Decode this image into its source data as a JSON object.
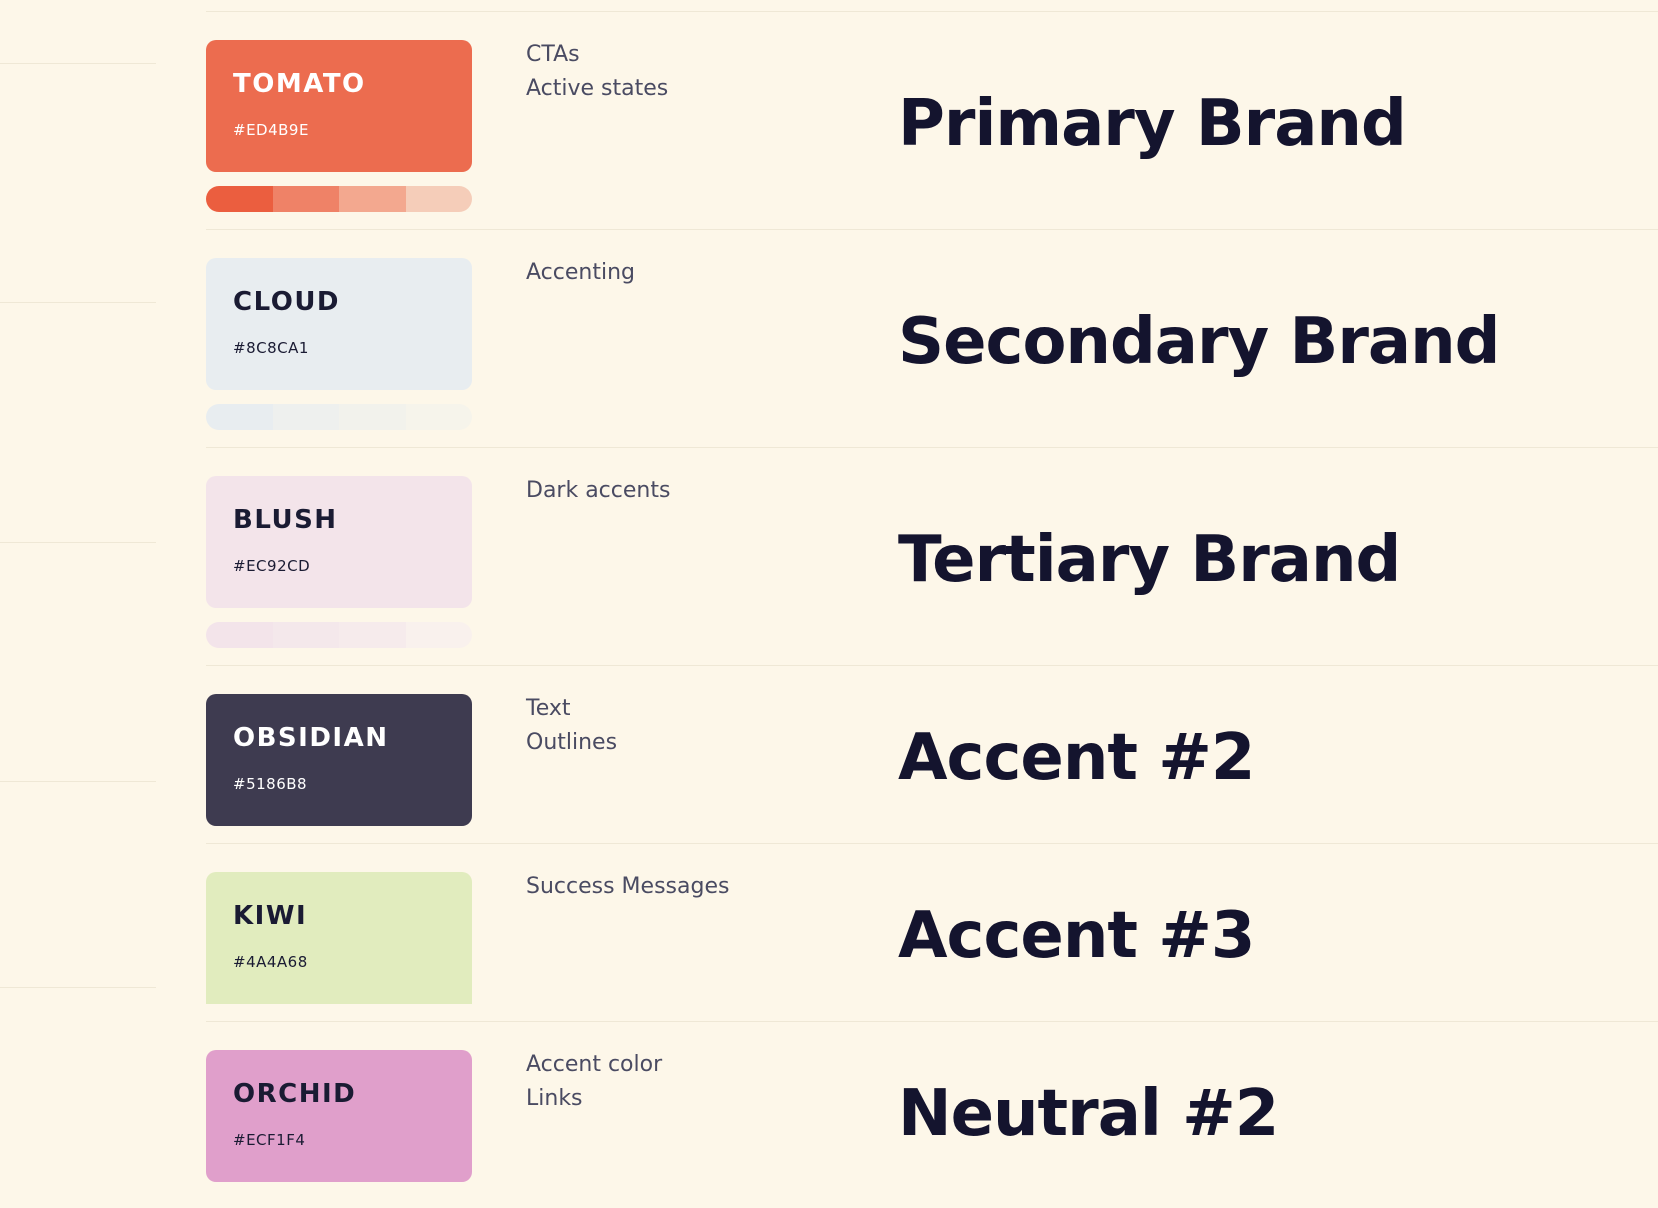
{
  "swatches": [
    {
      "name": "TOMATO",
      "hex": "#ED4B9E",
      "usage": [
        "CTAs",
        "Active states"
      ],
      "role": "Primary Brand",
      "fill": "#EC6C4F",
      "text_color": "#FFFFFF",
      "tints": [
        "#EB5E3F",
        "#EF8267",
        "#F3A88F",
        "#F5CDB9"
      ]
    },
    {
      "name": "CLOUD",
      "hex": "#8C8CA1",
      "usage": [
        "Accenting"
      ],
      "role": "Secondary Brand",
      "fill": "#E8EDF0",
      "text_color": "#1A1B33",
      "tints": [
        "#E8EDF0",
        "#EEF0EE",
        "#F2F2EC",
        "#F6F4EB"
      ]
    },
    {
      "name": "BLUSH",
      "hex": "#EC92CD",
      "usage": [
        "Dark accents"
      ],
      "role": "Tertiary Brand",
      "fill": "#F3E4EA",
      "text_color": "#1A1B33",
      "tints": [
        "#F3E4EA",
        "#F4E8EB",
        "#F6EBEC",
        "#F9F1ED"
      ]
    },
    {
      "name": "OBSIDIAN",
      "hex": "#5186B8",
      "usage": [
        "Text",
        "Outlines"
      ],
      "role": "Accent #2",
      "fill": "#3E3B50",
      "text_color": "#FFFFFF",
      "tints": []
    },
    {
      "name": "KIWI",
      "hex": "#4A4A68",
      "usage": [
        "Success Messages"
      ],
      "role": "Accent #3",
      "fill": "#E1ECBE",
      "text_color": "#1A1B33",
      "tints": []
    },
    {
      "name": "ORCHID",
      "hex": "#ECF1F4",
      "usage": [
        "Accent color",
        "Links"
      ],
      "role": "Neutral #2",
      "fill": "#E09FCB",
      "text_color": "#1A1B33",
      "tints": []
    }
  ]
}
